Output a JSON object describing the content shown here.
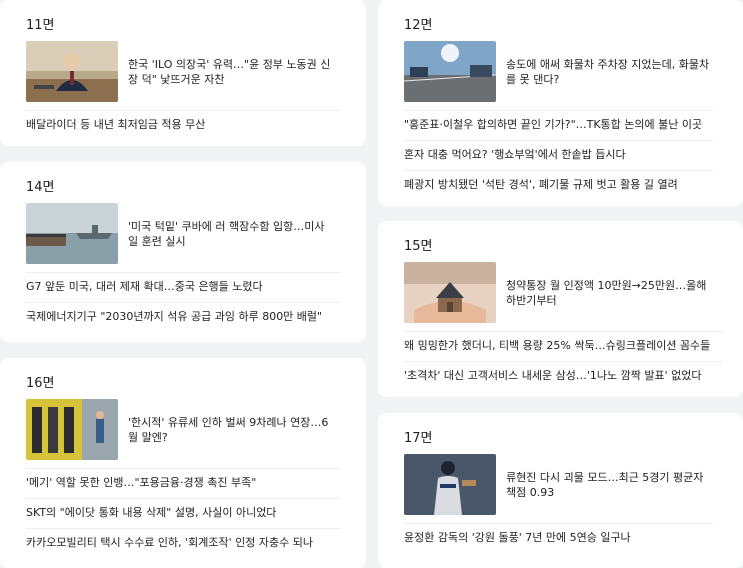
{
  "left_cards": [
    {
      "page": "11면",
      "lead_title": "한국 'ILO 의장국' 유력…\"윤 정부 노동권 신장 덕\" 낯뜨거운 자찬",
      "thumb_icon": "official-podium-photo",
      "items": [
        "배달라이더 등 내년 최저임금 적용 무산"
      ]
    },
    {
      "page": "14면",
      "lead_title": "'미국 턱밑' 쿠바에 러 핵잠수함 입항…미사일 훈련 실시",
      "thumb_icon": "warship-harbor-photo",
      "items": [
        "G7 앞둔 미국, 대러 제재 확대…중국 은행들 노렸다",
        "국제에너지기구 \"2030년까지 석유 공급 과잉 하루 800만 배럴\""
      ]
    },
    {
      "page": "16면",
      "lead_title": "'한시적' 유류세 인하 벌써 9차례나 연장…6월 말엔?",
      "thumb_icon": "gas-station-photo",
      "items": [
        "'메기' 역할 못한 인뱅…\"포용금융·경쟁 촉진 부족\"",
        "SKT의 \"에이닷 통화 내용 삭제\" 설명, 사실이 아니었다",
        "카카오모빌리티 택시 수수료 인하, '회계조작' 인정 자충수 되나"
      ]
    }
  ],
  "right_cards": [
    {
      "page": "12면",
      "lead_title": "송도에 애써 화물차 주차장 지었는데, 화물차를 못 댄다?",
      "thumb_icon": "truck-parking-photo",
      "items": [
        "\"홍준표·이철우 합의하면 끝인 기가?\"…TK통합 논의에 불난 이곳",
        "혼자 대충 먹어요? '행쇼부엌'에서 한솥밥 듭시다",
        "폐광지 방치됐던 '석탄 경석', 폐기물 규제 벗고 활용 길 열려"
      ]
    },
    {
      "page": "15면",
      "lead_title": "청약통장 월 인정액 10만원→25만원…올해 하반기부터",
      "thumb_icon": "house-model-hands-photo",
      "items": [
        "왜 밍밍한가 했더니, 티백 용량 25% 싹둑…슈링크플레이션 꼼수들",
        "'초격차' 대신 고객서비스 내세운 삼성…'1나노 깜짝 발표' 없었다"
      ]
    },
    {
      "page": "17면",
      "lead_title": "류현진 다시 괴물 모드…최근 5경기 평균자책점 0.93",
      "thumb_icon": "baseball-pitcher-photo",
      "items": [
        "윤정환 감독의 '강원 돌풍' 7년 만에 5연승 일구나"
      ]
    }
  ]
}
